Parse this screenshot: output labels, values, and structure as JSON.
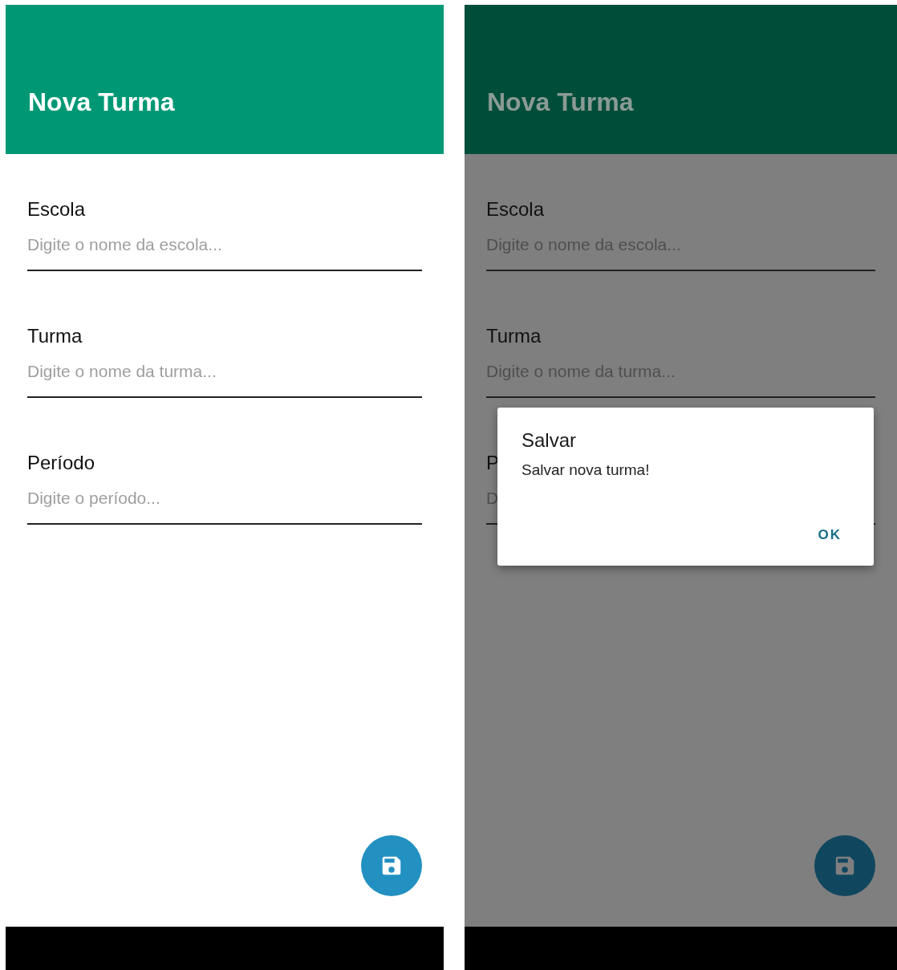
{
  "screens": [
    {
      "dimmed": false,
      "title": "Nova Turma",
      "fields": [
        {
          "label": "Escola",
          "placeholder": "Digite o nome da escola..."
        },
        {
          "label": "Turma",
          "placeholder": "Digite o nome da turma..."
        },
        {
          "label": "Período",
          "placeholder": "Digite o período..."
        }
      ]
    },
    {
      "dimmed": true,
      "title": "Nova Turma",
      "fields": [
        {
          "label": "Escola",
          "placeholder": "Digite o nome da escola..."
        },
        {
          "label": "Turma",
          "placeholder": "Digite o nome da turma..."
        },
        {
          "label": "P",
          "placeholder": "D"
        }
      ],
      "dialog": {
        "title": "Salvar",
        "message": "Salvar nova turma!",
        "button": "OK"
      }
    }
  ]
}
